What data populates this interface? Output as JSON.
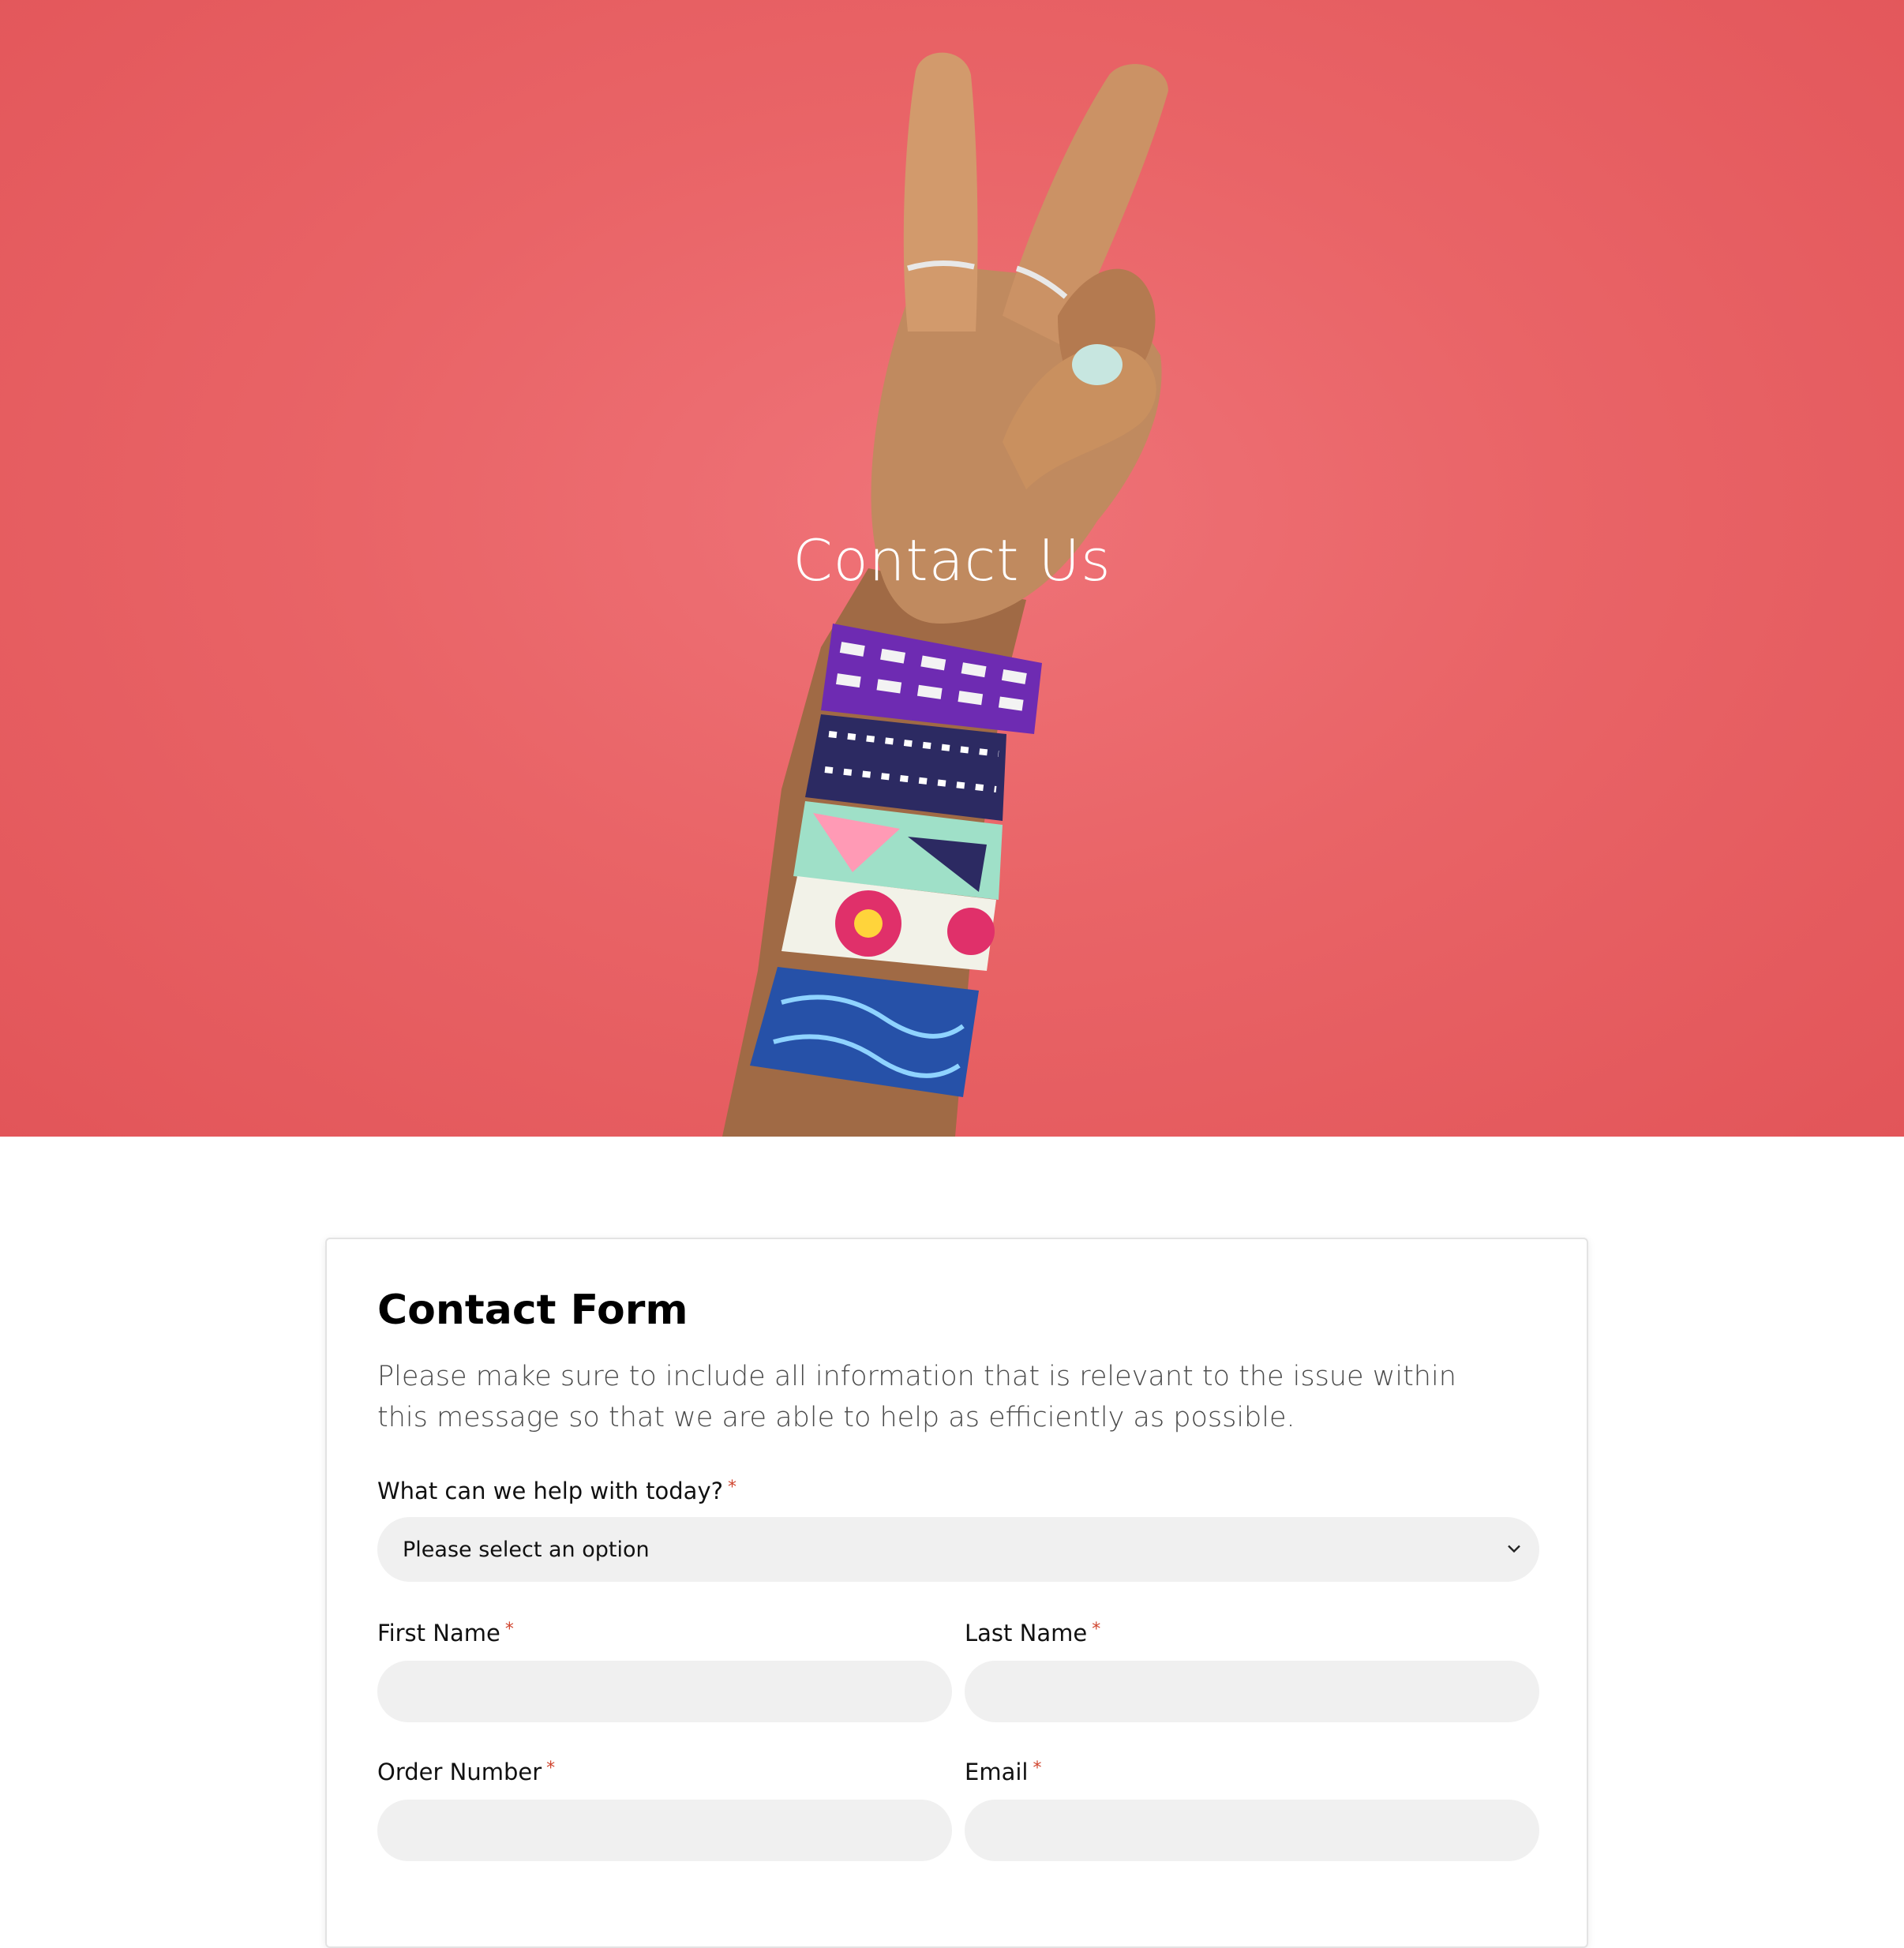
{
  "hero": {
    "title": "Contact Us",
    "background_color": "#e96467"
  },
  "form": {
    "title": "Contact Form",
    "description": "Please make sure to include all information that is relevant to the issue within this message so that we are able to help as efficiently as possible.",
    "required_marker": "*",
    "help_topic": {
      "label": "What can we help with today?",
      "selected": "Please select an option"
    },
    "first_name": {
      "label": "First Name",
      "value": ""
    },
    "last_name": {
      "label": "Last Name",
      "value": ""
    },
    "order_number": {
      "label": "Order Number",
      "value": ""
    },
    "email": {
      "label": "Email",
      "value": ""
    }
  },
  "colors": {
    "required": "#d0452f",
    "input_bg": "#f0f0f0"
  },
  "icons": {
    "select_chevron": "chevron-down-icon"
  }
}
